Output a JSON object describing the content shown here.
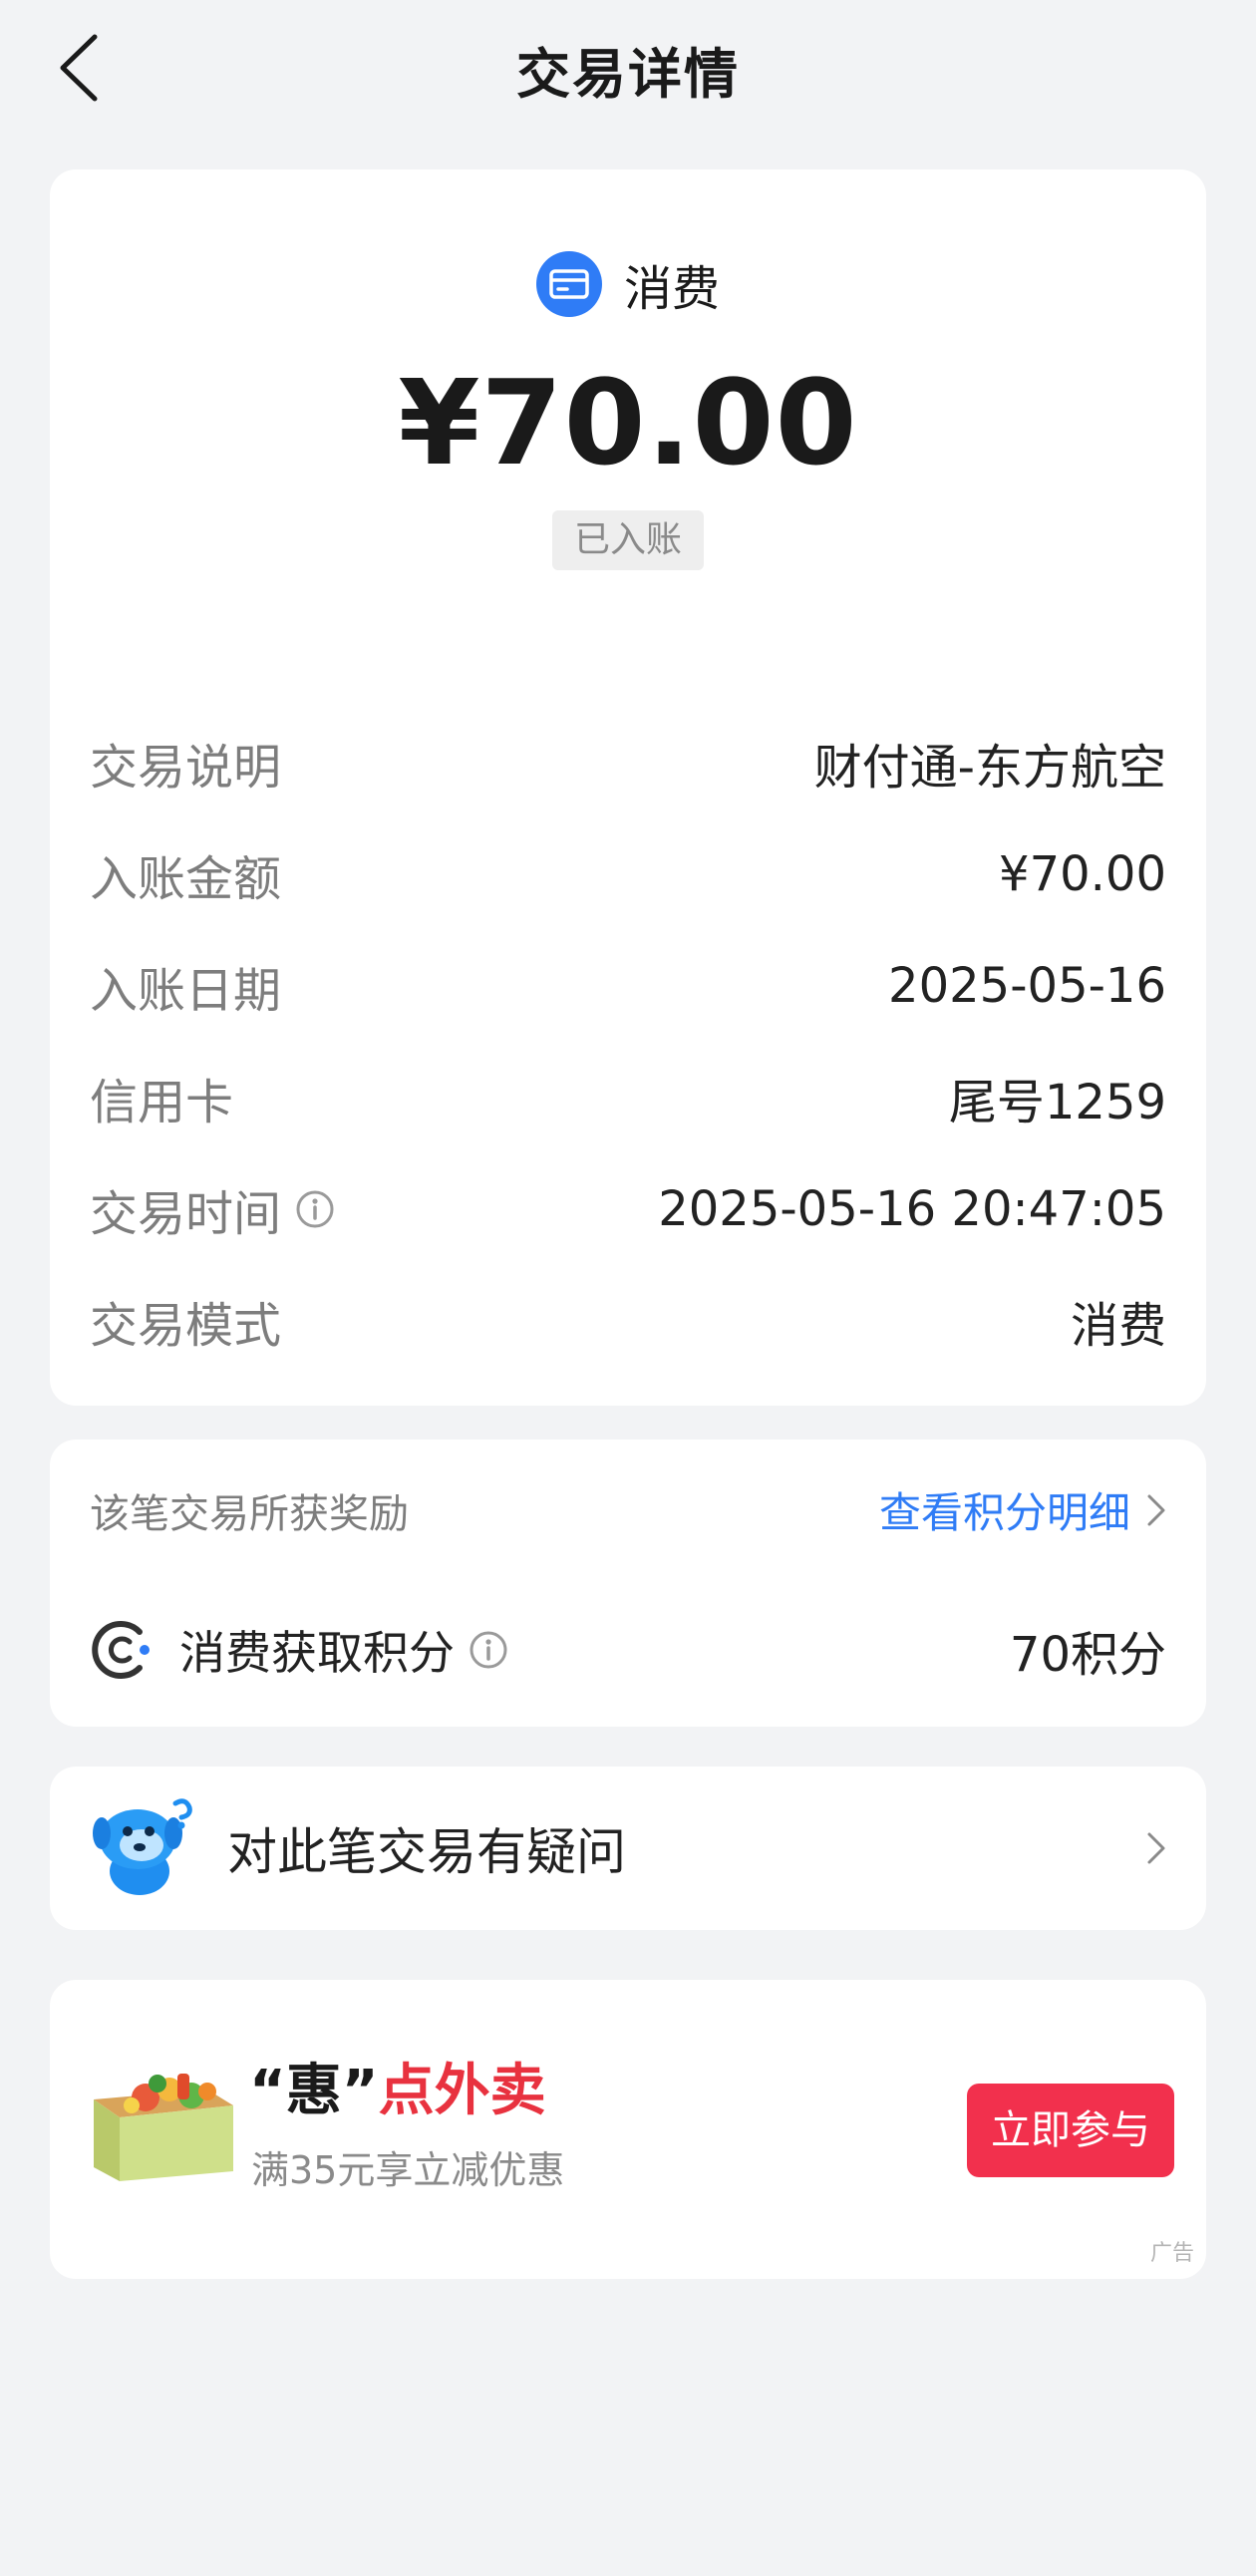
{
  "header": {
    "title": "交易详情"
  },
  "summary": {
    "type_label": "消费",
    "amount": "¥70.00",
    "status": "已入账"
  },
  "details": [
    {
      "label": "交易说明",
      "value": "财付通-东方航空"
    },
    {
      "label": "入账金额",
      "value": "¥70.00"
    },
    {
      "label": "入账日期",
      "value": "2025-05-16"
    },
    {
      "label": "信用卡",
      "value": "尾号1259"
    },
    {
      "label": "交易时间",
      "value": "2025-05-16 20:47:05"
    },
    {
      "label": "交易模式",
      "value": "消费"
    }
  ],
  "reward": {
    "title": "该笔交易所获奖励",
    "link": "查看积分明细",
    "label": "消费获取积分",
    "value": "70积分"
  },
  "question": {
    "label": "对此笔交易有疑问"
  },
  "ad": {
    "title_quote": "“惠”",
    "title_highlight": "点外卖",
    "subtitle": "满35元享立减优惠",
    "button": "立即参与",
    "tag": "广告"
  },
  "colors": {
    "accent": "#2f7cf6",
    "ad_button": "#f2304d",
    "ad_highlight": "#e8323f"
  },
  "icons": [
    "back-arrow-icon",
    "card-icon",
    "info-icon",
    "chevron-right-icon",
    "points-icon",
    "mascot-icon"
  ]
}
